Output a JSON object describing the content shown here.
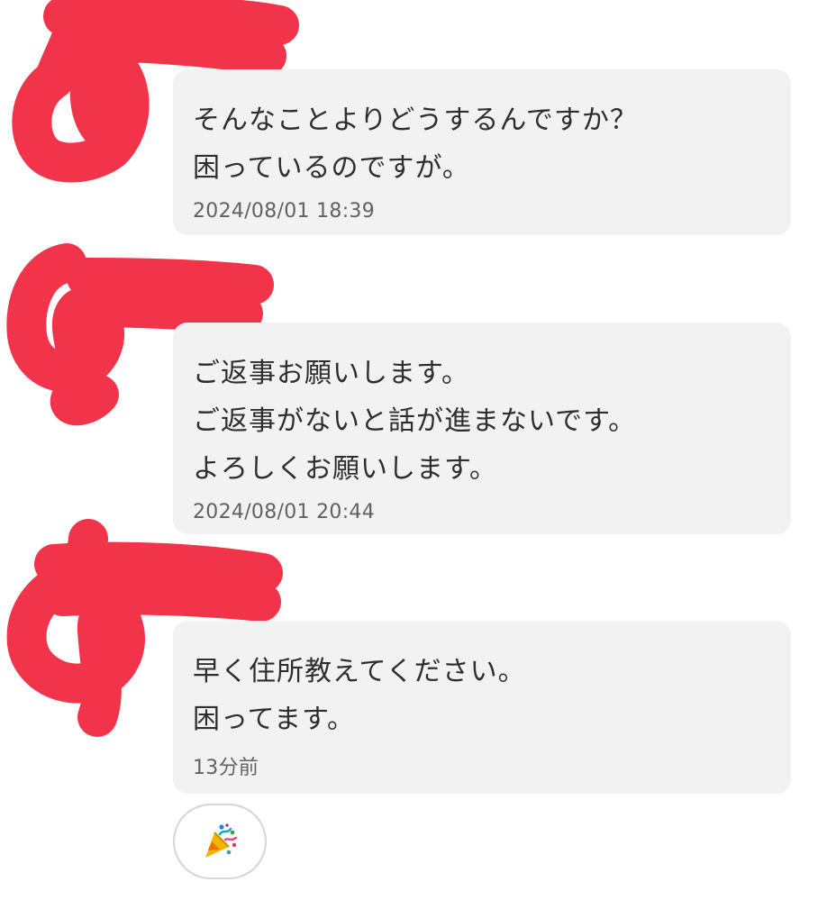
{
  "messages": [
    {
      "lines": [
        "そんなことよりどうするんですか？",
        "困っているのですが。"
      ],
      "timestamp": "2024/08/01 18:39"
    },
    {
      "lines": [
        "ご返事お願いします。",
        "ご返事がないと話が進まないです。",
        "よろしくお願いします。"
      ],
      "timestamp": "2024/08/01 20:44"
    },
    {
      "lines": [
        "早く住所教えてください。",
        "困ってます。"
      ],
      "timestamp": "13分前"
    }
  ],
  "reaction": {
    "icon": "party-popper-icon"
  },
  "colors": {
    "bubble_background": "#f2f2f2",
    "message_text": "#2e2e2e",
    "timestamp_text": "#616161",
    "redaction": "#f2344a"
  }
}
